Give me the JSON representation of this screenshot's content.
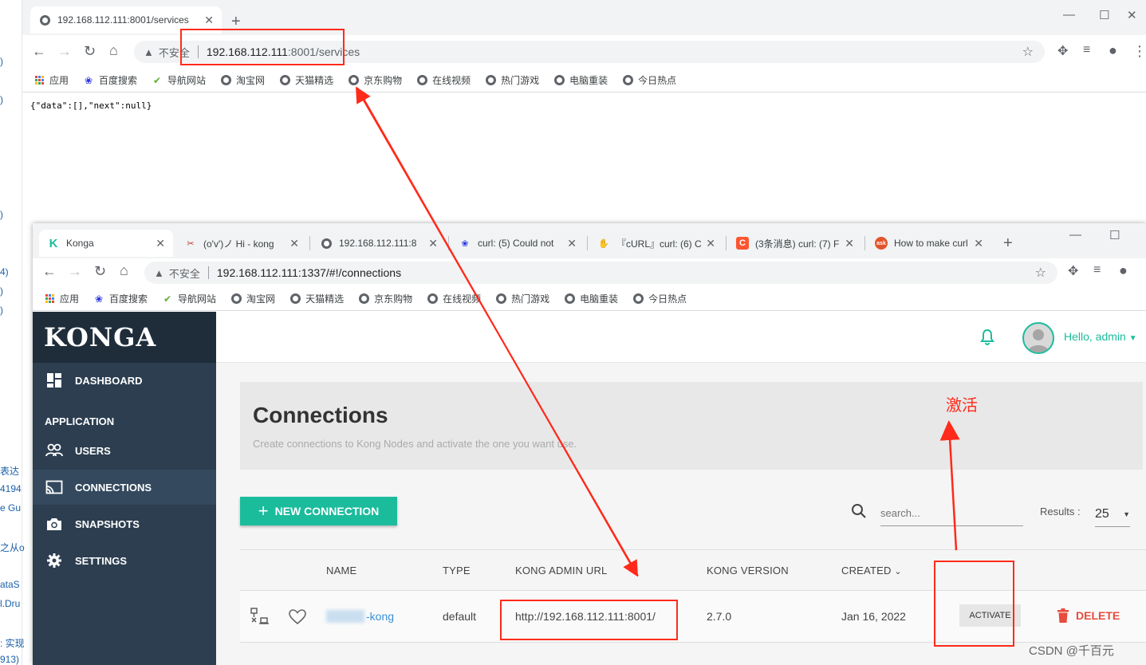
{
  "background_fragments": [
    ")",
    ")",
    ")",
    "4)",
    ")",
    ")",
    "表达",
    "4194",
    "e Gu",
    "之从o",
    "ataS",
    "l.Dru",
    ": 实现",
    "913)"
  ],
  "win1": {
    "tab_title": "192.168.112.111:8001/services",
    "new_tab": "+",
    "url": {
      "insecure_label": "不安全",
      "host": "192.168.112.111",
      "rest": ":8001/services"
    },
    "body_text": "{\"data\":[],\"next\":null}"
  },
  "bookmarks": [
    "应用",
    "百度搜索",
    "导航网站",
    "淘宝网",
    "天猫精选",
    "京东购物",
    "在线视频",
    "热门游戏",
    "电脑重装",
    "今日热点"
  ],
  "win2": {
    "tabs": [
      {
        "title": "Konga",
        "icon": "konga-icon"
      },
      {
        "title": "(o'v')ノ Hi - kong",
        "icon": "bow-icon"
      },
      {
        "title": "192.168.112.111:8",
        "icon": "globe-icon"
      },
      {
        "title": "curl: (5) Could not",
        "icon": "baidu-icon"
      },
      {
        "title": "『cURL』curl: (6) C",
        "icon": "hand-icon"
      },
      {
        "title": "(3条消息) curl: (7) F",
        "icon": "csdn-icon"
      },
      {
        "title": "How to make curl",
        "icon": "ask-icon"
      }
    ],
    "new_tab": "+",
    "url": {
      "insecure_label": "不安全",
      "text": "192.168.112.111:1337/#!/connections"
    }
  },
  "konga": {
    "logo": "KONGA",
    "nav": {
      "dashboard": "DASHBOARD",
      "section": "APPLICATION",
      "users": "USERS",
      "connections": "CONNECTIONS",
      "snapshots": "SNAPSHOTS",
      "settings": "SETTINGS"
    },
    "user_greeting": "Hello, admin",
    "page_title": "Connections",
    "page_subtitle": "Create connections to Kong Nodes and activate the one you want use.",
    "new_connection_label": "NEW CONNECTION",
    "search_placeholder": "search...",
    "results_label": "Results :",
    "results_value": "25",
    "table": {
      "headers": {
        "name": "NAME",
        "type": "TYPE",
        "url": "KONG ADMIN URL",
        "version": "KONG VERSION",
        "created": "CREATED"
      },
      "rows": [
        {
          "name": "-kong",
          "type": "default",
          "url": "http://192.168.112.111:8001/",
          "version": "2.7.0",
          "created": "Jan 16, 2022",
          "activate": "ACTIVATE",
          "delete": "DELETE"
        }
      ]
    },
    "accent_color": "#1abc9c",
    "sidebar_color": "#2c3e50",
    "danger_color": "#e74c3c"
  },
  "annotations": {
    "activate_note": "激活",
    "color": "#ff2a1a"
  },
  "watermark": "CSDN @千百元"
}
